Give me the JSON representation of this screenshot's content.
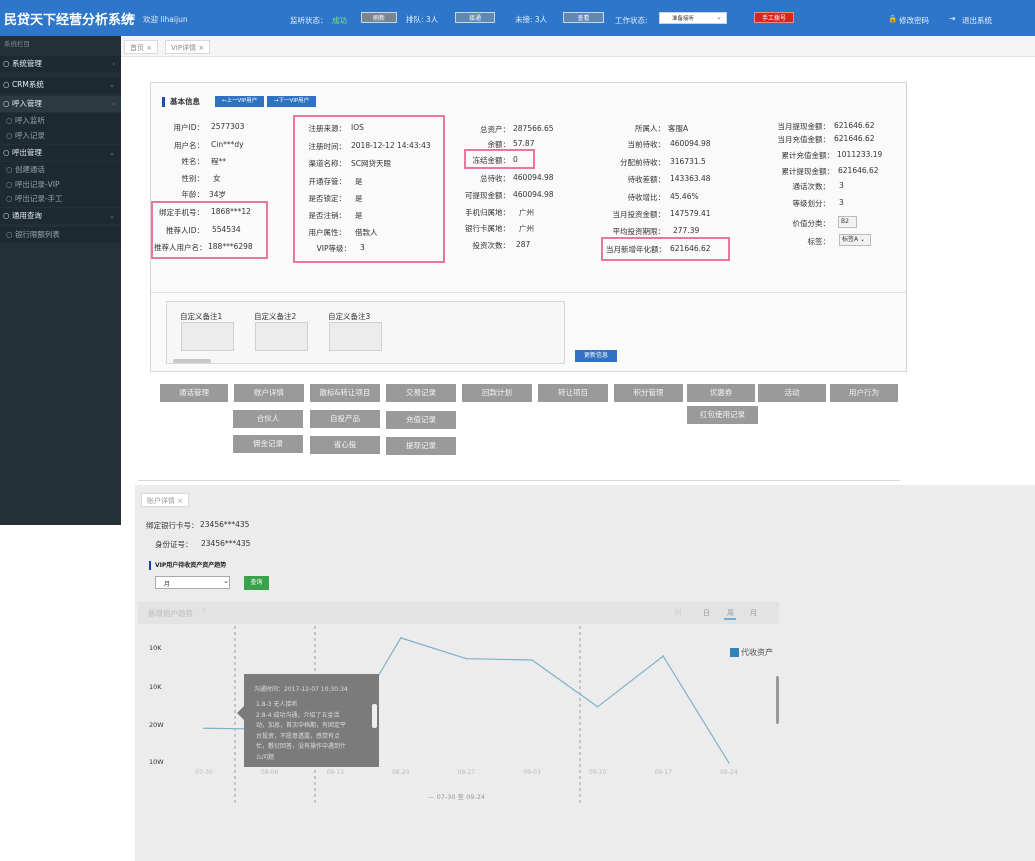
{
  "header": {
    "app_title": "民贷天下经营分析系统",
    "welcome": "欢迎 lihaijun",
    "monitor_label": "监听状态：",
    "monitor_value": "成功",
    "refresh_btn": "刷新",
    "queue_label": "排队: 3人",
    "connect_btn": "接通",
    "missed_label": "未接: 3人",
    "view_btn": "查看",
    "work_status_label": "工作状态:",
    "work_status_value": "准备接听",
    "manual_dial_btn": "手工拨号",
    "change_pwd": "修改密码",
    "logout": "退出系统"
  },
  "sidebar": {
    "title": "系统栏目",
    "items": [
      {
        "label": "系统管理"
      },
      {
        "label": "CRM系统"
      },
      {
        "label": "呼入管理"
      },
      {
        "label": "呼入监听"
      },
      {
        "label": "呼入记录"
      },
      {
        "label": "呼出管理"
      },
      {
        "label": "创建通话"
      },
      {
        "label": "呼出记录-VIP"
      },
      {
        "label": "呼出记录-手工"
      },
      {
        "label": "通用查询"
      },
      {
        "label": "银行限额列表"
      }
    ]
  },
  "tabs": [
    {
      "label": "首页"
    },
    {
      "label": "VIP详情"
    }
  ],
  "basic_info": {
    "title": "基本信息",
    "prev_btn": "←上一VIP用户",
    "next_btn": "→下一VIP用户",
    "col1": [
      {
        "label": "用户ID：",
        "value": "2577303"
      },
      {
        "label": "用户名：",
        "value": "Cin***dy"
      },
      {
        "label": "姓名：",
        "value": "程**"
      },
      {
        "label": "性别：",
        "value": "女"
      },
      {
        "label": "年龄：",
        "value": "34岁"
      },
      {
        "label": "绑定手机号：",
        "value": "1868***12"
      },
      {
        "label": "推荐人ID：",
        "value": "554534"
      },
      {
        "label": "推荐人用户名：",
        "value": "188***6298"
      }
    ],
    "col2": [
      {
        "label": "注册来源：",
        "value": "IOS"
      },
      {
        "label": "注册时间：",
        "value": "2018-12-12 14:43:43"
      },
      {
        "label": "渠道名称：",
        "value": "SC网贷天眼"
      },
      {
        "label": "开通存管：",
        "value": "是"
      },
      {
        "label": "是否锁定：",
        "value": "是"
      },
      {
        "label": "是否注销：",
        "value": "是"
      },
      {
        "label": "用户属性：",
        "value": "借款人"
      },
      {
        "label": "VIP等级：",
        "value": "3"
      }
    ],
    "col3": [
      {
        "label": "总资产：",
        "value": "287566.65"
      },
      {
        "label": "余额：",
        "value": "57.87"
      },
      {
        "label": "冻结金额：",
        "value": "0"
      },
      {
        "label": "总待收：",
        "value": "460094.98"
      },
      {
        "label": "可提现金额：",
        "value": "460094.98"
      },
      {
        "label": "手机归属地：",
        "value": "广州"
      },
      {
        "label": "银行卡属地：",
        "value": "广州"
      },
      {
        "label": "投资次数：",
        "value": "287"
      }
    ],
    "col4": [
      {
        "label": "所属人：",
        "value": "客服A"
      },
      {
        "label": "当前待收：",
        "value": "460094.98"
      },
      {
        "label": "分配前待收：",
        "value": "316731.5"
      },
      {
        "label": "待收差额：",
        "value": "143363.48"
      },
      {
        "label": "待收增比：",
        "value": "45.46%"
      },
      {
        "label": "当月投资金额：",
        "value": "147579.41"
      },
      {
        "label": "平均投资期限：",
        "value": "277.39"
      },
      {
        "label": "当月新增年化额：",
        "value": "621646.62"
      }
    ],
    "col5": [
      {
        "label": "当月提现金额：",
        "value": "621646.62"
      },
      {
        "label": "当月充值金额：",
        "value": "621646.62"
      },
      {
        "label": "累计充值金额：",
        "value": "1011233.19"
      },
      {
        "label": "累计提现金额：",
        "value": "621646.62"
      },
      {
        "label": "通话次数：",
        "value": "3"
      },
      {
        "label": "等级划分：",
        "value": "3"
      },
      {
        "label": "价值分类：",
        "value": "B2"
      },
      {
        "label": "标签：",
        "value": "标签A"
      }
    ],
    "memo1": "自定义备注1",
    "memo2": "自定义备注2",
    "memo3": "自定义备注3",
    "update_btn": "更新信息"
  },
  "action_buttons": [
    [
      "通话管理",
      "账户详情",
      "散标&转让项目",
      "交易记录",
      "回款计划",
      "转让项目",
      "积分管理",
      "优惠券",
      "活动",
      "用户行为"
    ],
    [
      "合伙人",
      "自投产品",
      "充值记录",
      "红包使用记录"
    ],
    [
      "佣金记录",
      "省心投",
      "提现记录"
    ]
  ],
  "account_detail": {
    "tab": "账户详情",
    "bank_card_label": "绑定银行卡号：",
    "bank_card_value": "23456***435",
    "id_label": "身份证号：",
    "id_value": "23456***435",
    "trend_title": "VIP用户待收资产资产趋势",
    "select_value": "月",
    "query_btn": "查询"
  },
  "chart_panel": {
    "title": "新增用户趋势",
    "periods": [
      "时",
      "日",
      "周",
      "月"
    ],
    "legend": "代收资产",
    "tooltip_time": "沟通时间：2017-12-07 10:30:34",
    "tooltip_lines": [
      "1.8-3 无人接听",
      "2.8-4 成功沟通，介绍了五金活",
      "动，加息，首次中档期，有固定平",
      "台投资，不愿意透露，感觉有点",
      "忙，敷衍回答，没有操作中遇到什",
      "么问题"
    ],
    "range_text": "— 07-30 至 09-24"
  },
  "chart_data": {
    "type": "line",
    "categories": [
      "07-30",
      "08-06",
      "08-13",
      "08-20",
      "08-27",
      "09-03",
      "09-10",
      "09-17",
      "09-24"
    ],
    "y_tick_labels": [
      "10K",
      "10K",
      "20W",
      "10W"
    ],
    "series": [
      {
        "name": "代收资产",
        "values": [
          27.5,
          26.8,
          12,
          97,
          81,
          80,
          44,
          83,
          1
        ]
      }
    ],
    "ylim": [
      0,
      100
    ],
    "grid": false,
    "legend_position": "top-right"
  },
  "colors": {
    "header": "#2d76c9",
    "sidebar": "#243038",
    "highlight": "#e8769f",
    "primary_btn": "#2f72c3",
    "success": "#3aa24a",
    "danger": "#d9261c",
    "series": "#7fb1c9"
  }
}
